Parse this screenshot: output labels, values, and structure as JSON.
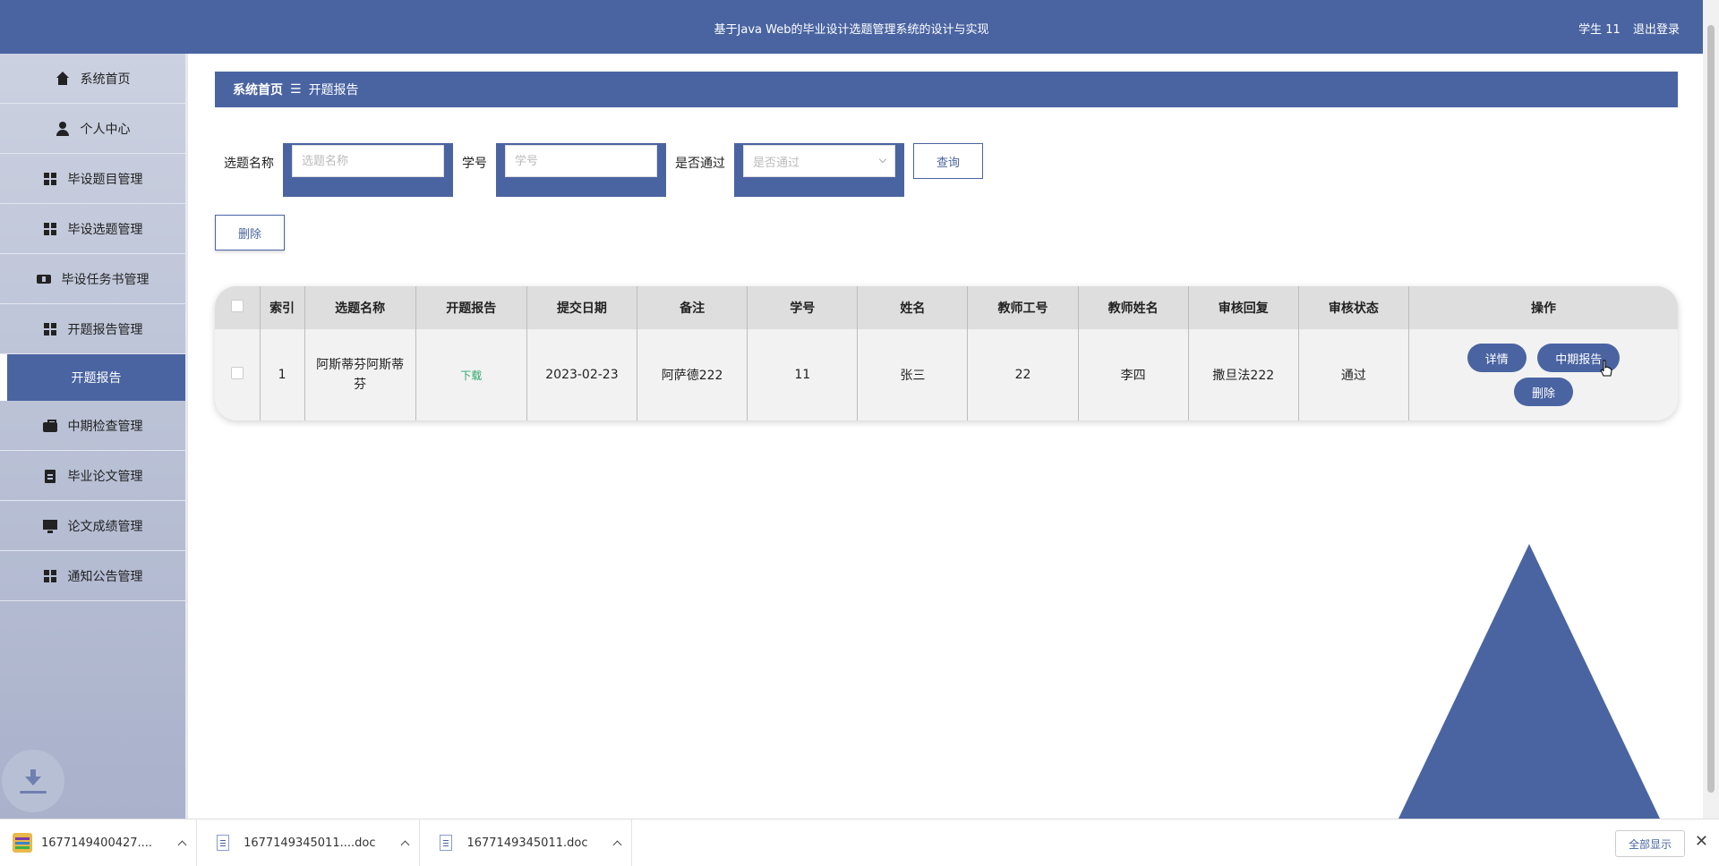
{
  "header": {
    "title": "基于Java Web的毕业设计选题管理系统的设计与实现",
    "user": "学生 11",
    "logout": "退出登录"
  },
  "sidebar": {
    "items": [
      {
        "label": "系统首页",
        "icon": "home-icon"
      },
      {
        "label": "个人中心",
        "icon": "user-icon"
      },
      {
        "label": "毕设题目管理",
        "icon": "grid-icon"
      },
      {
        "label": "毕设选题管理",
        "icon": "grid-icon"
      },
      {
        "label": "毕设任务书管理",
        "icon": "ticket-icon"
      },
      {
        "label": "开题报告管理",
        "icon": "grid-icon"
      },
      {
        "label": "开题报告",
        "icon": ""
      },
      {
        "label": "中期检查管理",
        "icon": "briefcase-icon"
      },
      {
        "label": "毕业论文管理",
        "icon": "clipboard-icon"
      },
      {
        "label": "论文成绩管理",
        "icon": "monitor-icon"
      },
      {
        "label": "通知公告管理",
        "icon": "grid-icon"
      }
    ]
  },
  "breadcrumb": {
    "home": "系统首页",
    "separator": "☰",
    "current": "开题报告"
  },
  "search": {
    "topic_label": "选题名称",
    "topic_placeholder": "选题名称",
    "student_label": "学号",
    "student_placeholder": "学号",
    "pass_label": "是否通过",
    "pass_placeholder": "是否通过",
    "query_button": "查询"
  },
  "actions": {
    "delete_button": "删除"
  },
  "table": {
    "headers": [
      "索引",
      "选题名称",
      "开题报告",
      "提交日期",
      "备注",
      "学号",
      "姓名",
      "教师工号",
      "教师姓名",
      "审核回复",
      "审核状态",
      "操作"
    ],
    "rows": [
      {
        "index": "1",
        "topic": "阿斯蒂芬阿斯蒂芬",
        "report": "下载",
        "date": "2023-02-23",
        "remark": "阿萨德222",
        "student_no": "11",
        "name": "张三",
        "teacher_no": "22",
        "teacher_name": "李四",
        "reply": "撒旦法222",
        "status": "通过",
        "ops": {
          "detail": "详情",
          "midterm": "中期报告",
          "delete": "删除"
        }
      }
    ]
  },
  "downloads": {
    "items": [
      {
        "name": "1677149400427....",
        "type": "zip"
      },
      {
        "name": "1677149345011....doc",
        "type": "doc"
      },
      {
        "name": "1677149345011.doc",
        "type": "doc"
      }
    ],
    "show_all": "全部显示",
    "close": "✕"
  },
  "colors": {
    "primary": "#4a64a2",
    "sidebar_bg": "#b9c0d6",
    "link_green": "#2ea86b"
  }
}
